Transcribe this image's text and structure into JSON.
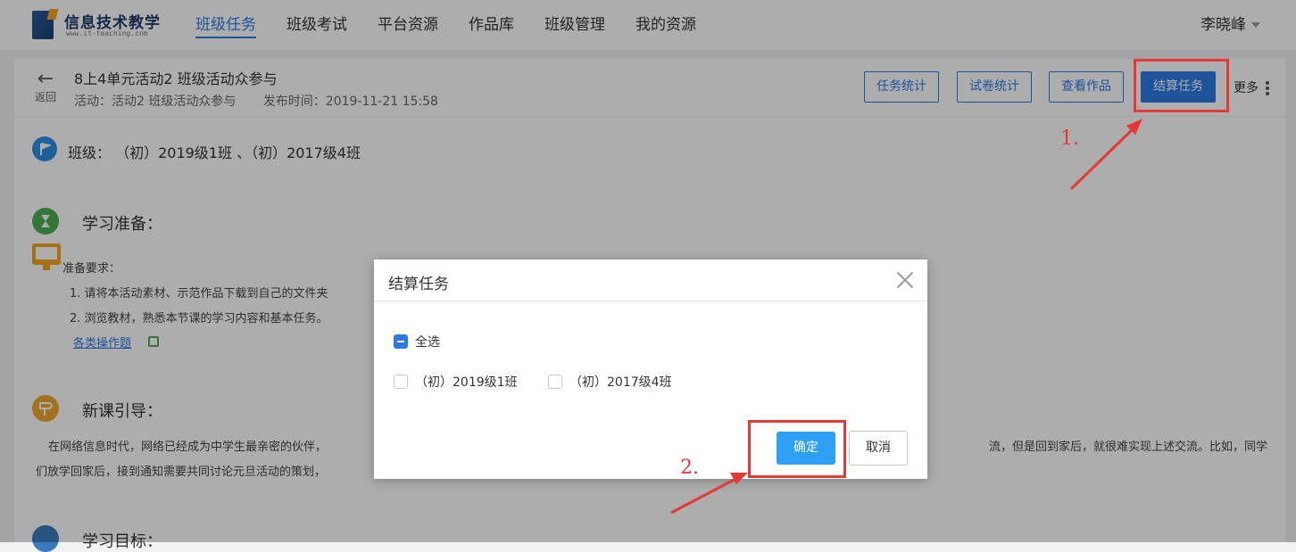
{
  "topnav": {
    "logo_title": "信息技术教学",
    "logo_sub": "www.it-teaching.com",
    "items": [
      "班级任务",
      "班级考试",
      "平台资源",
      "作品库",
      "班级管理",
      "我的资源"
    ],
    "active_index": 0,
    "user": "李晓峰"
  },
  "subheader": {
    "back_label": "返回",
    "title": "8上4单元活动2 班级活动众参与",
    "activity": "活动：活动2 班级活动众参与",
    "publish_time": "发布时间：2019-11-21 15:58",
    "buttons": {
      "task_stats": "任务统计",
      "exam_stats": "试卷统计",
      "view_works": "查看作品",
      "settle_task": "结算任务"
    },
    "more": "更多"
  },
  "content": {
    "class_line": "班级： （初）2019级1班 、（初）2017级4班",
    "prep_title": "学习准备：",
    "prep_label": "准备要求：",
    "prep_items": [
      "1. 请将本活动素材、示范作品下载到自己的文件夹",
      "2. 浏览教材，熟悉本节课的学习内容和基本任务。"
    ],
    "prep_link": "各类操作题",
    "intro_title": "新课引导：",
    "intro_para_left_1": "在网络信息时代，网络已经成为中学生最亲密的伙伴，",
    "intro_para_right_1": "流，但是回到家后，就很难实现上述交流。比如，同学",
    "intro_para_left_2": "们放学回家后，接到通知需要共同讨论元旦活动的策划，",
    "goal_title": "学习目标："
  },
  "modal": {
    "title": "结算任务",
    "select_all": "全选",
    "options": [
      "（初）2019级1班",
      "（初）2017级4班"
    ],
    "confirm": "确定",
    "cancel": "取消"
  },
  "annotations": {
    "step1": "1.",
    "step2": "2."
  },
  "colors": {
    "accent": "#2c7be5",
    "confirm": "#2d9ff5",
    "annotation": "#e53935"
  }
}
